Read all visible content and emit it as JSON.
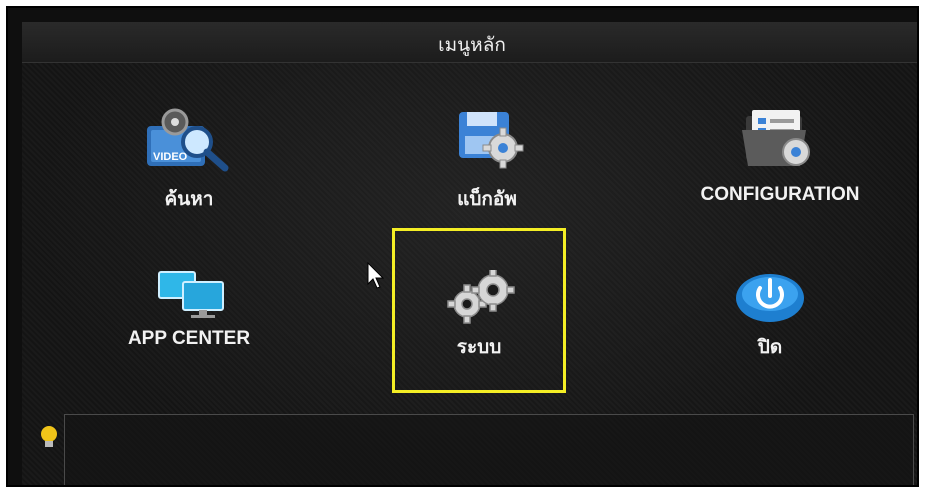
{
  "window": {
    "title": "เมนูหลัก"
  },
  "menu": {
    "items": [
      {
        "id": "search",
        "label": "ค้นหา",
        "icon": "video-search-icon"
      },
      {
        "id": "backup",
        "label": "แบ็กอัพ",
        "icon": "backup-disk-gear-icon"
      },
      {
        "id": "configuration",
        "label": "CONFIGURATION",
        "icon": "config-folder-gear-icon"
      },
      {
        "id": "app-center",
        "label": "APP CENTER",
        "icon": "monitors-icon"
      },
      {
        "id": "system",
        "label": "ระบบ",
        "icon": "gears-icon",
        "highlighted": true
      },
      {
        "id": "close",
        "label": "ปิด",
        "icon": "power-icon"
      }
    ]
  },
  "info": {
    "icon": "lightbulb-icon",
    "text": ""
  },
  "colors": {
    "highlight": "#f4ee25",
    "background": "#141414",
    "text": "#f2f2f2"
  }
}
